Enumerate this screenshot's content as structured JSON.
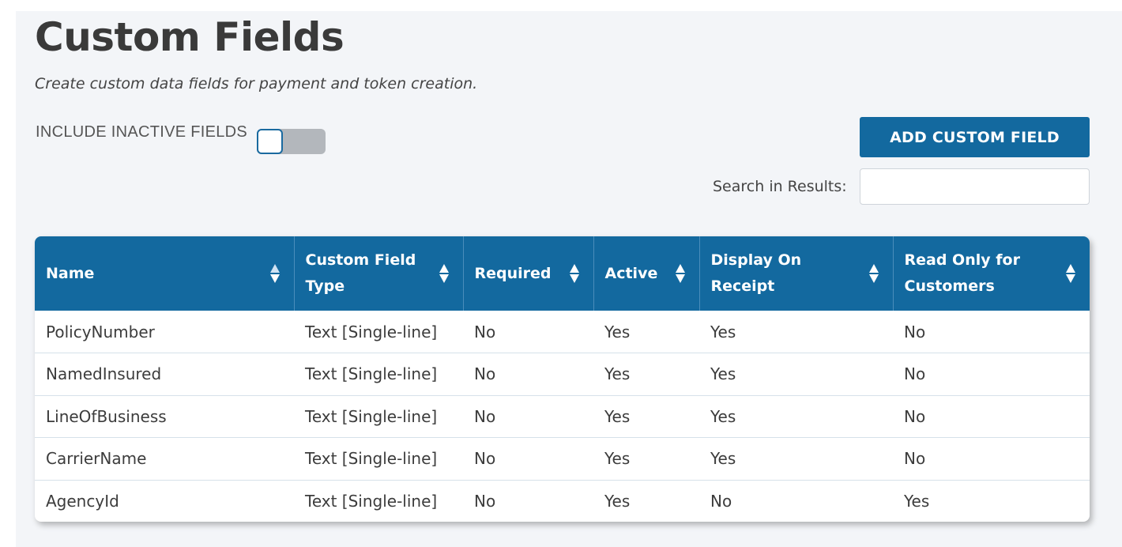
{
  "page": {
    "title": "Custom Fields",
    "subtitle": "Create custom data fields for payment and token creation."
  },
  "toggle": {
    "label": "INCLUDE INACTIVE FIELDS",
    "state": "off"
  },
  "actions": {
    "add_label": "ADD CUSTOM FIELD"
  },
  "search": {
    "label": "Search in Results:",
    "value": ""
  },
  "table": {
    "columns": [
      {
        "label": "Name"
      },
      {
        "label": "Custom Field Type"
      },
      {
        "label": "Required"
      },
      {
        "label": "Active"
      },
      {
        "label": "Display On Receipt"
      },
      {
        "label": "Read Only for Customers"
      }
    ],
    "rows": [
      [
        "PolicyNumber",
        "Text [Single-line]",
        "No",
        "Yes",
        "Yes",
        "No"
      ],
      [
        "NamedInsured",
        "Text [Single-line]",
        "No",
        "Yes",
        "Yes",
        "No"
      ],
      [
        "LineOfBusiness",
        "Text [Single-line]",
        "No",
        "Yes",
        "Yes",
        "No"
      ],
      [
        "CarrierName",
        "Text [Single-line]",
        "No",
        "Yes",
        "Yes",
        "No"
      ],
      [
        "AgencyId",
        "Text [Single-line]",
        "No",
        "Yes",
        "No",
        "Yes"
      ]
    ]
  },
  "colors": {
    "accent": "#13699f",
    "background": "#f3f5f8",
    "toggle_off": "#b3b7bc"
  },
  "icons": {
    "sort": "sort-icon"
  }
}
